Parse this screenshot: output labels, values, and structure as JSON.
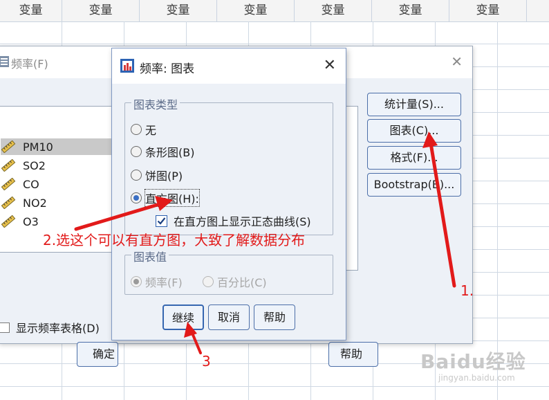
{
  "spreadsheet": {
    "column_header": "变量",
    "columns": [
      "变量",
      "变量",
      "变量",
      "变量",
      "变量",
      "变量",
      "变量"
    ]
  },
  "background_dialog": {
    "title": "频率(F)",
    "variables": [
      {
        "name": "PM10",
        "selected": true
      },
      {
        "name": "SO2",
        "selected": false
      },
      {
        "name": "CO",
        "selected": false
      },
      {
        "name": "NO2",
        "selected": false
      },
      {
        "name": "O3",
        "selected": false
      }
    ],
    "side_buttons": {
      "statistics": "统计量(S)...",
      "charts": "图表(C)...",
      "format": "格式(F)...",
      "bootstrap": "Bootstrap(B)..."
    },
    "display_freq_tables": "显示频率表格(D)",
    "ok_button": "确定",
    "help_button": "帮助"
  },
  "charts_dialog": {
    "title": "频率: 图表",
    "chart_type_group": "图表类型",
    "options": [
      {
        "label": "无",
        "selected": false
      },
      {
        "label": "条形图(B)",
        "selected": false
      },
      {
        "label": "饼图(P)",
        "selected": false
      },
      {
        "label": "直方图(H):",
        "selected": true
      }
    ],
    "normal_curve_label": "在直方图上显示正态曲线(S)",
    "normal_curve_checked": true,
    "chart_values_group": "图表值",
    "value_options": [
      {
        "label": "频率(F)",
        "selected": true,
        "enabled": false
      },
      {
        "label": "百分比(C)",
        "selected": false,
        "enabled": false
      }
    ],
    "buttons": {
      "continue": "继续",
      "cancel": "取消",
      "help": "帮助"
    }
  },
  "annotations": {
    "note": "2.选这个可以有直方图，大致了解数据分布",
    "step1": "1.",
    "step3": "3"
  },
  "watermark": {
    "main": "Baidu经验",
    "sub": "jingyan.baidu.com"
  },
  "colors": {
    "annotation": "#e21a1a",
    "button_border": "#4b6ea8",
    "dialog_bg": "#edf1f7"
  }
}
